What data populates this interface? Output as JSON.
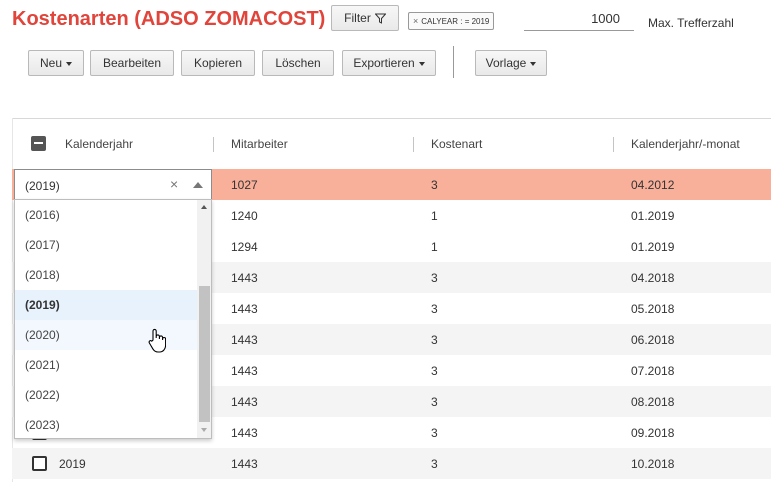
{
  "header": {
    "title": "Kostenarten (ADSO ZOMACOST)",
    "filter_label": "Filter",
    "filter_chip": "CALYEAR : = 2019",
    "max_hits_value": "1000",
    "max_hits_label": "Max. Trefferzahl"
  },
  "toolbar": {
    "new_label": "Neu",
    "edit_label": "Bearbeiten",
    "copy_label": "Kopieren",
    "delete_label": "Löschen",
    "export_label": "Exportieren",
    "template_label": "Vorlage"
  },
  "table": {
    "columns": [
      "Kalenderjahr",
      "Mitarbeiter",
      "Kostenart",
      "Kalenderjahr/-monat"
    ],
    "rows": [
      {
        "year": "",
        "employee": "1027",
        "cost_type": "3",
        "period": "04.2012"
      },
      {
        "year": "",
        "employee": "1240",
        "cost_type": "1",
        "period": "01.2019"
      },
      {
        "year": "",
        "employee": "1294",
        "cost_type": "1",
        "period": "01.2019"
      },
      {
        "year": "",
        "employee": "1443",
        "cost_type": "3",
        "period": "04.2018"
      },
      {
        "year": "",
        "employee": "1443",
        "cost_type": "3",
        "period": "05.2018"
      },
      {
        "year": "",
        "employee": "1443",
        "cost_type": "3",
        "period": "06.2018"
      },
      {
        "year": "",
        "employee": "1443",
        "cost_type": "3",
        "period": "07.2018"
      },
      {
        "year": "",
        "employee": "1443",
        "cost_type": "3",
        "period": "08.2018"
      },
      {
        "year": "",
        "employee": "1443",
        "cost_type": "3",
        "period": "09.2018"
      },
      {
        "year": "2019",
        "employee": "1443",
        "cost_type": "3",
        "period": "10.2018"
      }
    ]
  },
  "combo": {
    "value": "(2019)",
    "options": [
      "(2016)",
      "(2017)",
      "(2018)",
      "(2019)",
      "(2020)",
      "(2021)",
      "(2022)",
      "(2023)"
    ],
    "selected": "(2019)",
    "hovered": "(2020)"
  },
  "colors": {
    "title": "#e0443a",
    "selected_row": "#f8b09b",
    "selected_option": "#e8f2fc"
  },
  "icons": [
    "filter-icon",
    "clear-icon",
    "caret-down-icon",
    "hand-cursor-icon"
  ]
}
